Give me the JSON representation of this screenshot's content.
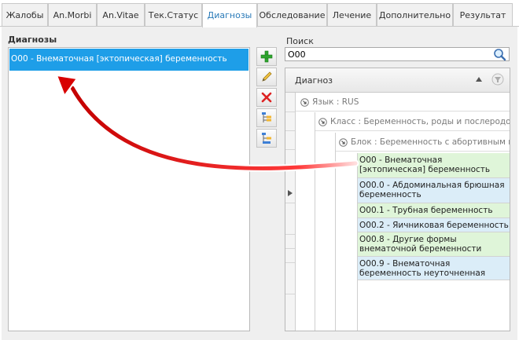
{
  "tabs": [
    {
      "label": "Жалобы",
      "active": false
    },
    {
      "label": "An.Morbi",
      "active": false
    },
    {
      "label": "An.Vitae",
      "active": false
    },
    {
      "label": "Тек.Статус",
      "active": false
    },
    {
      "label": "Диагнозы",
      "active": true
    },
    {
      "label": "Обследование",
      "active": false
    },
    {
      "label": "Лечение",
      "active": false
    },
    {
      "label": "Дополнительно",
      "active": false
    },
    {
      "label": "Результат",
      "active": false
    }
  ],
  "diagnoses_panel": {
    "title": "Диагнозы",
    "items": [
      {
        "label": "O00 - Внематочная [эктопическая] беременность",
        "selected": true
      }
    ]
  },
  "toolbar": {
    "buttons": [
      {
        "icon": "add-icon"
      },
      {
        "icon": "edit-pencil-icon"
      },
      {
        "icon": "delete-x-icon"
      },
      {
        "icon": "tree-expand-icon"
      },
      {
        "icon": "tree-collapse-icon"
      }
    ]
  },
  "search": {
    "label": "Поиск",
    "value": "O00"
  },
  "grid": {
    "column_header": "Диагноз",
    "groups": [
      {
        "label": "Язык : RUS"
      },
      {
        "label": "Класс : Беременность, роды и послеродов"
      },
      {
        "label": "Блок : Беременность с абортивным ис"
      }
    ],
    "rows": [
      {
        "label": "O00 - Внематочная [эктопическая] беременность",
        "color": "green"
      },
      {
        "label": "O00.0 - Абдоминальная  брюшная беременность",
        "color": "blue"
      },
      {
        "label": "O00.1 - Трубная беременность",
        "color": "green"
      },
      {
        "label": "O00.2 - Яичниковая беременность",
        "color": "blue"
      },
      {
        "label": "O00.8 - Другие формы внематочной беременности",
        "color": "green"
      },
      {
        "label": "O00.9 - Внематочная беременность неуточненная",
        "color": "blue"
      }
    ]
  },
  "colors": {
    "selection": "#1e9ee8",
    "active_tab_text": "#2a7ab8",
    "row_green": "#dff5d9",
    "row_blue": "#dbedf8",
    "annotation_arrow": "#e01b1b"
  }
}
